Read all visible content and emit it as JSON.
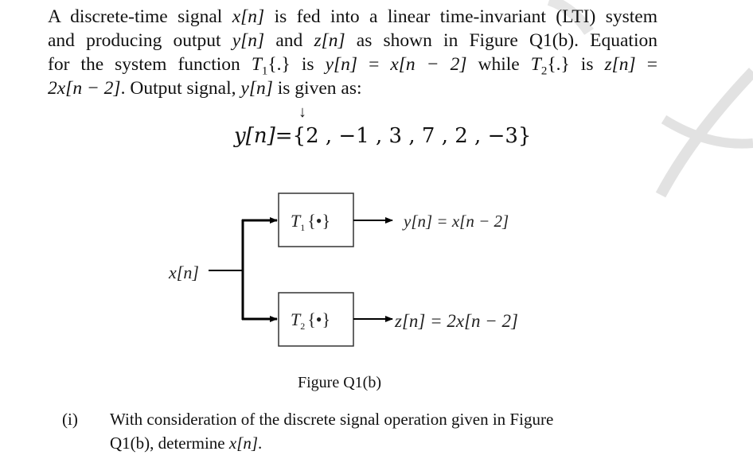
{
  "watermark": {
    "icon": "faint-logo-watermark",
    "color": "#e2e2e2"
  },
  "paragraph": {
    "line1": {
      "t1": "A discrete-time signal ",
      "m1": "x[n]",
      "t2": " is fed into a linear time-invariant (LTI) system"
    },
    "line2": {
      "t1": "and producing output ",
      "m1": "y[n]",
      "t2": " and ",
      "m2": "z[n]",
      "t3": " as shown in Figure Q1(b). Equation"
    },
    "line3": {
      "t1": "for the system function ",
      "m1": "T",
      "s1": "1",
      "t2": "{.} is ",
      "m2": "y[n]",
      "t3": " = ",
      "m3": "x[n − 2]",
      "t4": " while ",
      "m4": "T",
      "s2": "2",
      "t5": "{.} is ",
      "m5": "z[n]",
      "t6": " ="
    },
    "line4": {
      "m1": "2x[n − 2]",
      "t1": ". Output signal, ",
      "m2": "y[n]",
      "t2": " is given as:"
    }
  },
  "arrow": "↓",
  "output_signal": {
    "lhs": "y[n]",
    "eq": "=",
    "values": [
      "2",
      "−1",
      "3",
      "7",
      "2",
      "−3"
    ]
  },
  "diagram": {
    "input_label": "x[n]",
    "block1": {
      "name": "T",
      "sub": "1",
      "arg": "{•}"
    },
    "block2": {
      "name": "T",
      "sub": "2",
      "arg": "{•}"
    },
    "output1": "y[n] = x[n − 2]",
    "output2": "z[n] = 2x[n − 2]"
  },
  "caption": "Figure Q1(b)",
  "question": {
    "number": "(i)",
    "line1": "With consideration of the discrete signal operation given in Figure",
    "line2_text": "Q1(b), determine ",
    "line2_math": "x[n]",
    "line2_end": "."
  }
}
